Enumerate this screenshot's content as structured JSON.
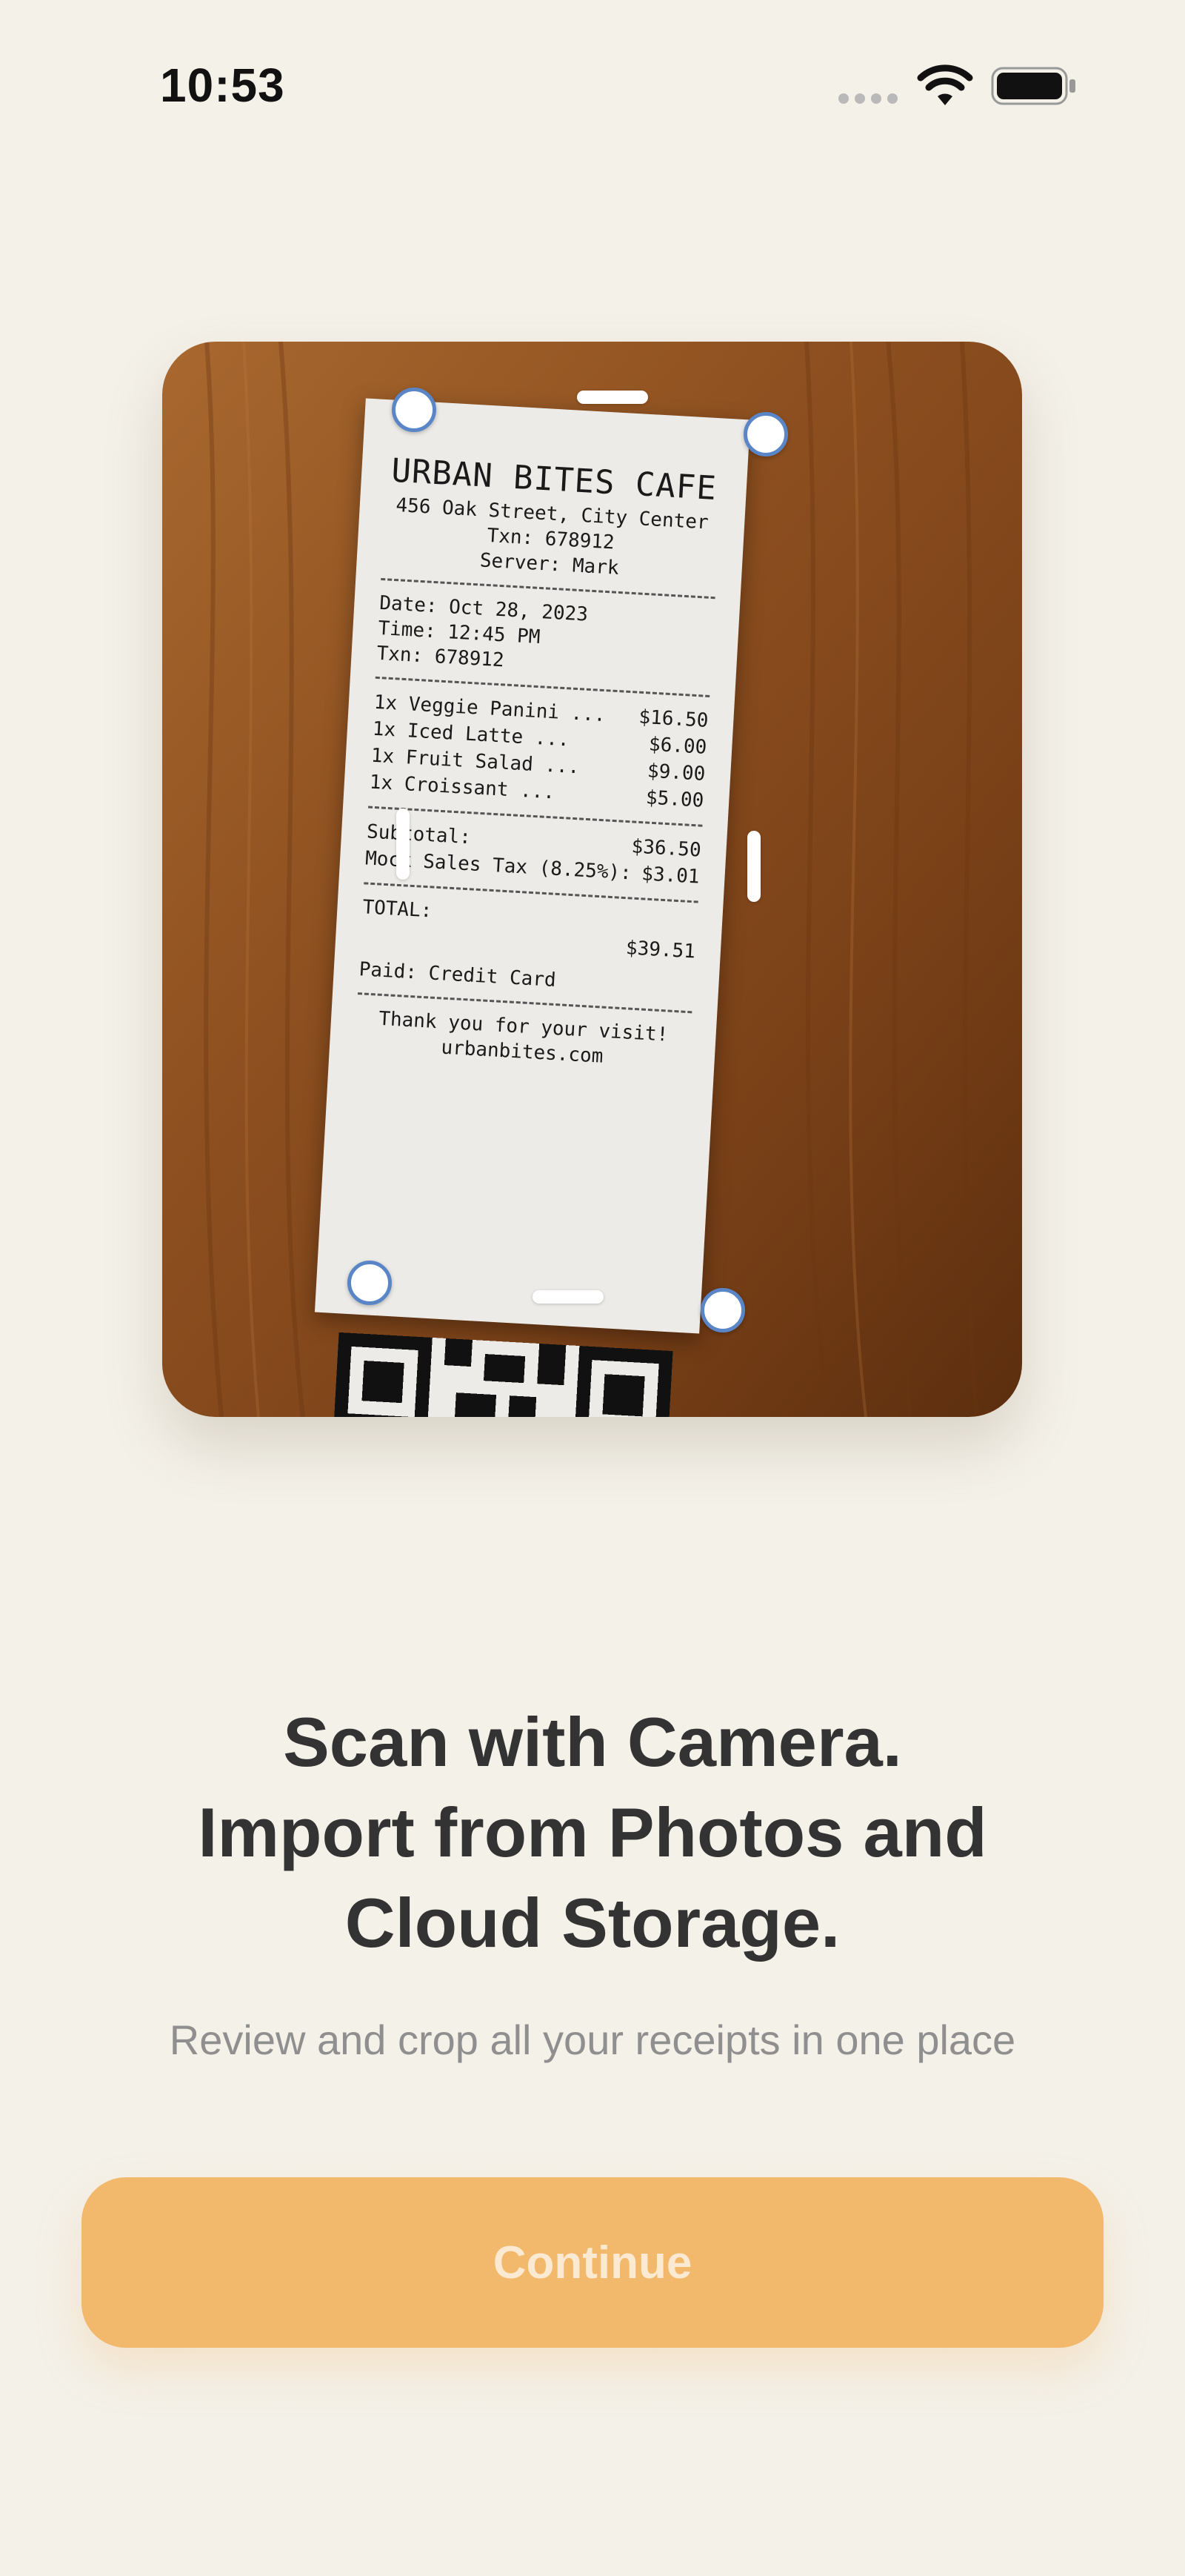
{
  "status_bar": {
    "time": "10:53"
  },
  "receipt": {
    "store": "URBAN BITES CAFE",
    "address": "456 Oak Street, City Center",
    "txn_header": "Txn: 678912",
    "server": "Server: Mark",
    "date": "Date: Oct 28, 2023",
    "time": "Time: 12:45 PM",
    "txn": "Txn: 678912",
    "items": [
      {
        "name": "1x Veggie Panini ...",
        "price": "$16.50"
      },
      {
        "name": "1x Iced Latte ...",
        "price": "$6.00"
      },
      {
        "name": "1x Fruit Salad ...",
        "price": "$9.00"
      },
      {
        "name": "1x Croissant ...",
        "price": "$5.00"
      }
    ],
    "subtotal_label": "Subtotal:",
    "subtotal": "$36.50",
    "tax_label": "Mock Sales Tax (8.25%):",
    "tax": "$3.01",
    "total_label": "TOTAL:",
    "total": "$39.51",
    "paid": "Paid: Credit Card",
    "thanks": "Thank you for your visit!",
    "website": "urbanbites.com"
  },
  "headline": {
    "line1": "Scan with Camera.",
    "line2": "Import from Photos and",
    "line3": "Cloud Storage."
  },
  "subtitle": "Review and crop all your receipts in one place",
  "continue_label": "Continue",
  "colors": {
    "background": "#f4f1e9",
    "accent": "#f2b86c",
    "crop_handle": "#5a86c8"
  }
}
